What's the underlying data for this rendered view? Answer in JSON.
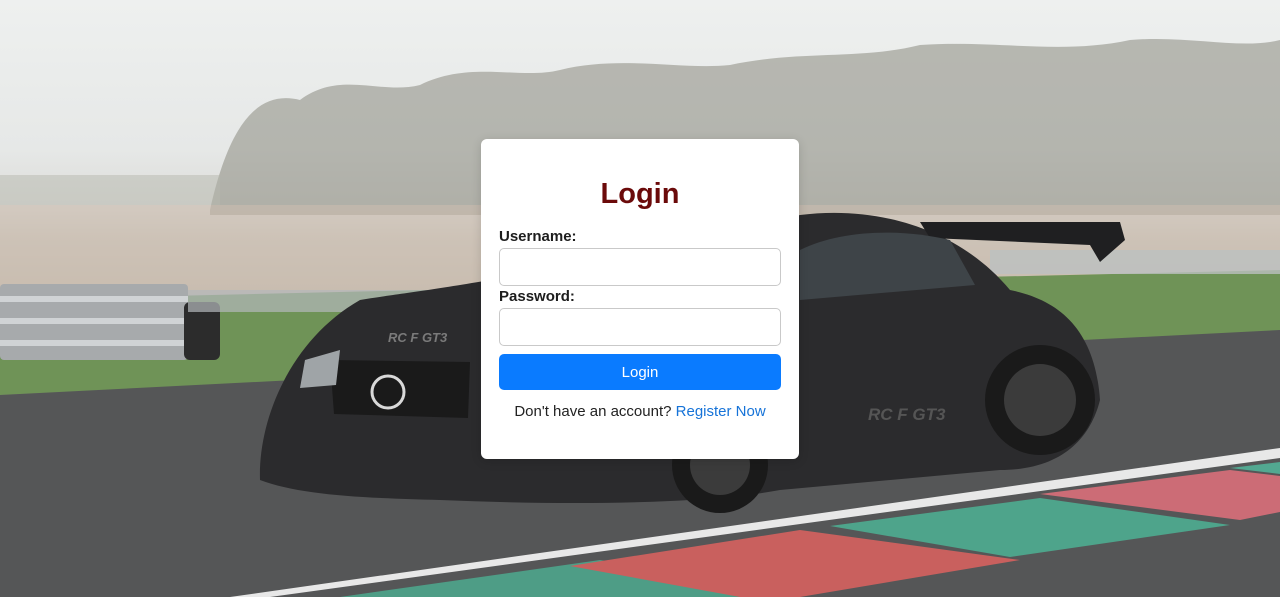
{
  "login": {
    "title": "Login",
    "username_label": "Username:",
    "username_value": "",
    "password_label": "Password:",
    "password_value": "",
    "submit_label": "Login",
    "register_prompt": "Don't have an account?",
    "register_link": "Register Now"
  },
  "background": {
    "car_badge": "RC F GT3"
  },
  "colors": {
    "title": "#6b0a0a",
    "button": "#0a7bff",
    "link": "#1673d8"
  }
}
